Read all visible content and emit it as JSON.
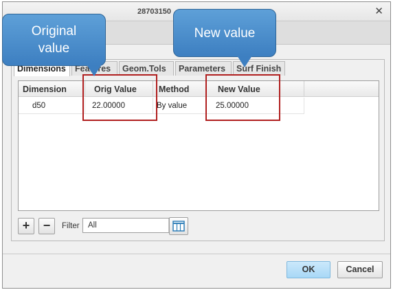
{
  "window": {
    "title": "28703150"
  },
  "tabs": [
    {
      "label": "Dimensions"
    },
    {
      "label": "Features"
    },
    {
      "label": "Geom.Tols"
    },
    {
      "label": "Parameters"
    },
    {
      "label": "Surf Finish"
    }
  ],
  "table": {
    "columns": [
      "Dimension",
      "Orig Value",
      "Method",
      "New Value"
    ],
    "rows": [
      {
        "dimension": "d50",
        "orig_value": "22.00000",
        "method": "By value",
        "new_value": "25.00000"
      }
    ]
  },
  "toolbar": {
    "add_symbol": "+",
    "remove_symbol": "−",
    "filter_label": "Filter",
    "filter_value": "All"
  },
  "buttons": {
    "ok": "OK",
    "cancel": "Cancel"
  },
  "annotations": {
    "original": "Original value",
    "new": "New value"
  },
  "icons": {
    "close": "close-icon",
    "add": "plus-icon",
    "remove": "minus-icon",
    "dropdown": "chevron-down-icon",
    "columns": "table-columns-icon"
  },
  "colors": {
    "callout": "#4a8acb",
    "highlight": "#b01e1e",
    "ok_button": "#b9e0f8"
  }
}
